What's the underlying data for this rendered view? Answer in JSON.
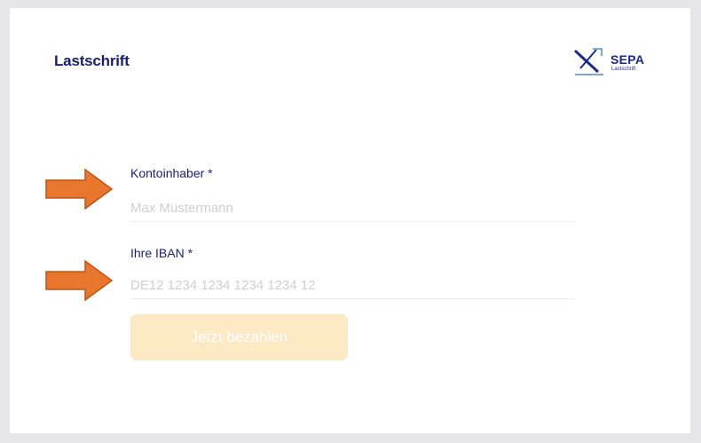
{
  "card": {
    "title": "Lastschrift",
    "logo": {
      "brand": "SEPA",
      "subtitle": "Lastschrift",
      "color": "#1d2a86"
    }
  },
  "form": {
    "account_holder": {
      "label": "Kontoinhaber *",
      "placeholder": "Max Mustermann",
      "value": ""
    },
    "iban": {
      "label": "Ihre IBAN *",
      "placeholder": "DE12 1234 1234 1234 1234 12",
      "value": ""
    },
    "submit_label": "Jetzt bezahlen"
  },
  "annotations": {
    "arrow_color": "#e8762c"
  },
  "colors": {
    "title": "#1a1f6e",
    "button_bg": "#fde9c4",
    "background": "#e6e6ea"
  }
}
